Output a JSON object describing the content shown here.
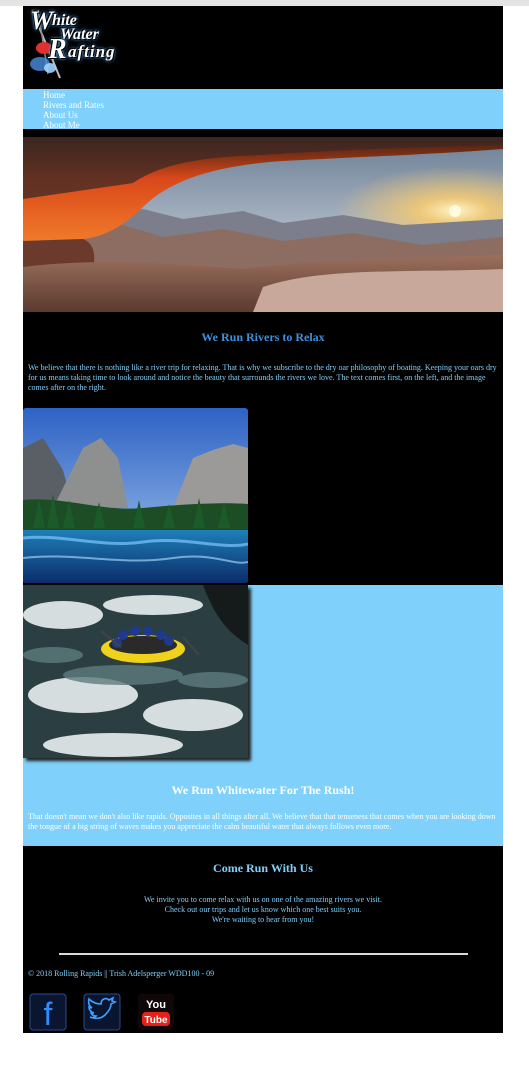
{
  "logo": {
    "line1": "hite",
    "line2": "Water",
    "line3": "afting",
    "initial_w": "W",
    "initial_r": "R"
  },
  "nav": {
    "items": [
      "Home",
      "Rivers and Rates",
      "About Us",
      "About Me"
    ]
  },
  "section1": {
    "title": "We Run Rivers to Relax",
    "body": "We believe that there is nothing like a river trip for relaxing. That is why we subscribe to the dry oar philosophy of boating. Keeping your oars dry for us means taking time to look around and notice the beauty that surrounds the rivers we love. The text comes first, on the left, and the image comes after on the right."
  },
  "section2": {
    "title": "We Run Whitewater For The Rush!",
    "body": "That doesn't mean we don't also like rapids. Opposites in all things after all. We believe that that tenseness that comes when you are looking down the tongue of a big string of waves makes you appreciate the calm beautiful water that always follows even more."
  },
  "section3": {
    "title": "Come Run With Us",
    "lines": [
      "We invite you to come relax with us on one of the amazing rivers we visit.",
      "Check out our trips and let us know which one best suits you.",
      "We're waiting to hear from you!"
    ]
  },
  "footer": {
    "copyright": "© 2018 Rolling Rapids || Trish Adelsperger WDD100 - 09",
    "social": [
      {
        "name": "facebook-icon",
        "glyph": "f"
      },
      {
        "name": "twitter-icon",
        "glyph": ""
      },
      {
        "name": "youtube-icon",
        "glyph": "You",
        "glyph2": "Tube"
      }
    ]
  },
  "colors": {
    "accent": "#7fd1fb",
    "background": "#000000",
    "heading": "#3d8fe0"
  }
}
